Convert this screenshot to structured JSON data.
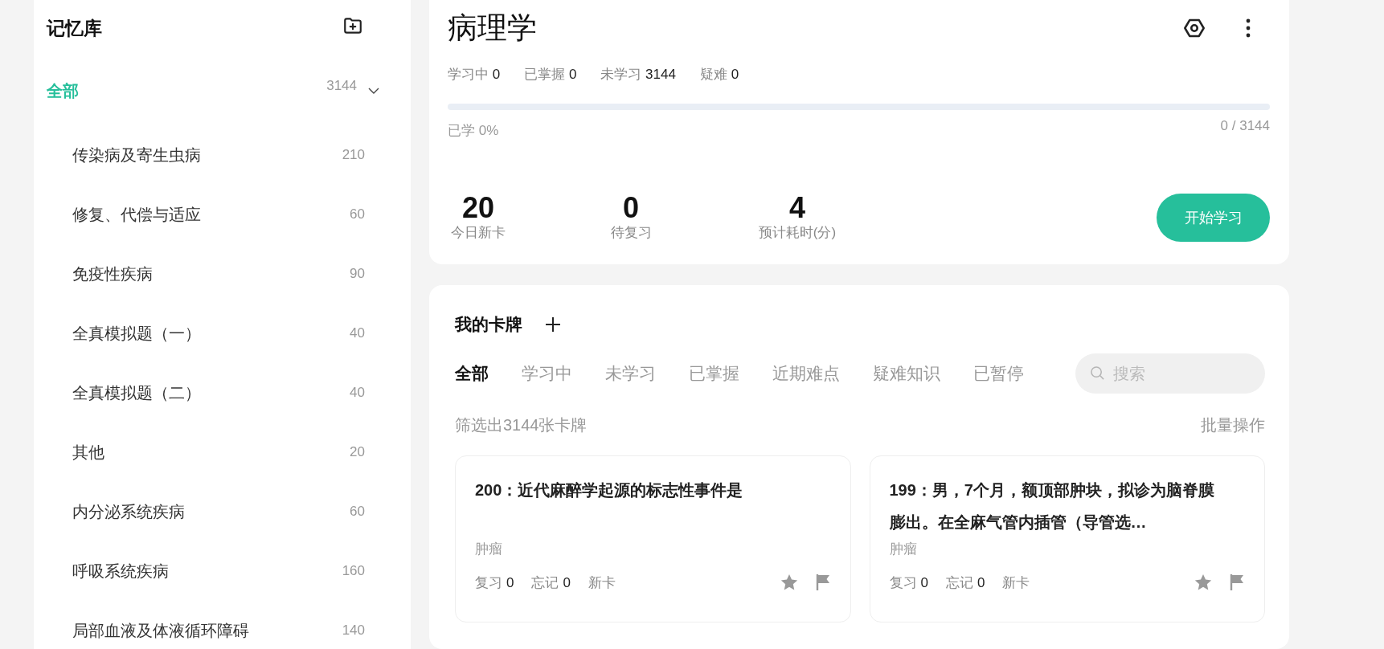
{
  "sidebar": {
    "title": "记忆库",
    "all": {
      "label": "全部",
      "count": "3144",
      "selected": true,
      "expanded": true
    },
    "items": [
      {
        "label": "传染病及寄生虫病",
        "count": "210",
        "selected": false
      },
      {
        "label": "修复、代偿与适应",
        "count": "60",
        "selected": false
      },
      {
        "label": "免疫性疾病",
        "count": "90",
        "selected": false
      },
      {
        "label": "全真模拟题（一）",
        "count": "40",
        "selected": false
      },
      {
        "label": "全真模拟题（二）",
        "count": "40",
        "selected": false
      },
      {
        "label": "其他",
        "count": "20",
        "selected": false
      },
      {
        "label": "内分泌系统疾病",
        "count": "60",
        "selected": false
      },
      {
        "label": "呼吸系统疾病",
        "count": "160",
        "selected": false
      },
      {
        "label": "局部血液及体液循环障碍",
        "count": "140",
        "selected": false
      }
    ]
  },
  "deck": {
    "title": "病理学",
    "stats": [
      {
        "label": "学习中",
        "value": "0"
      },
      {
        "label": "已掌握",
        "value": "0"
      },
      {
        "label": "未学习",
        "value": "3144"
      },
      {
        "label": "疑难",
        "value": "0"
      }
    ],
    "progress": {
      "level": 0,
      "caption": "已学 0%",
      "count": "0 / 3144"
    },
    "summary": [
      {
        "value": "20",
        "label": "今日新卡"
      },
      {
        "value": "0",
        "label": "待复习"
      },
      {
        "value": "4",
        "label": "预计耗时(分)"
      }
    ],
    "start_button": "开始学习"
  },
  "cards_panel": {
    "title": "我的卡牌",
    "tabs": [
      {
        "label": "全部",
        "selected": true
      },
      {
        "label": "学习中",
        "selected": false
      },
      {
        "label": "未学习",
        "selected": false
      },
      {
        "label": "已掌握",
        "selected": false
      },
      {
        "label": "近期难点",
        "selected": false
      },
      {
        "label": "疑难知识",
        "selected": false
      },
      {
        "label": "已暂停",
        "selected": false
      }
    ],
    "search": {
      "placeholder": "搜索"
    },
    "filter_count": "筛选出3144张卡牌",
    "batch_action": "批量操作",
    "cards": [
      {
        "title": "200：近代麻醉学起源的标志性事件是",
        "tag": "肿瘤",
        "stats": [
          {
            "label": "复习",
            "value": "0"
          },
          {
            "label": "忘记",
            "value": "0"
          },
          {
            "label": "新卡"
          }
        ],
        "starred": false,
        "flagged": false
      },
      {
        "title": "199：男，7个月，额顶部肿块，拟诊为脑脊膜膨出。在全麻气管内插管（导管选…",
        "tag": "肿瘤",
        "stats": [
          {
            "label": "复习",
            "value": "0"
          },
          {
            "label": "忘记",
            "value": "0"
          },
          {
            "label": "新卡"
          }
        ],
        "starred": false,
        "flagged": false
      }
    ]
  }
}
